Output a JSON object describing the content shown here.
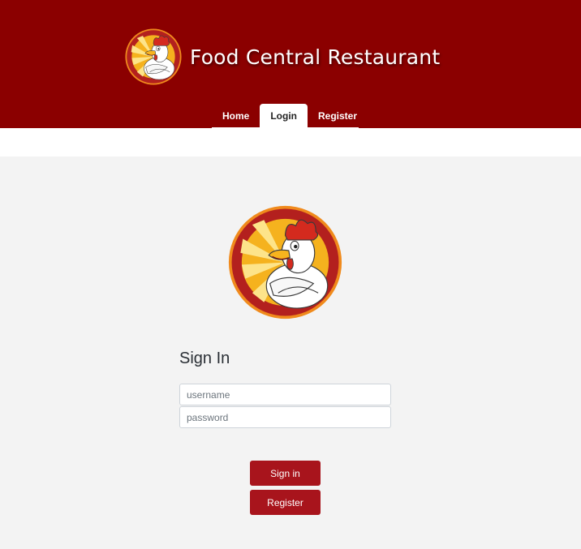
{
  "header": {
    "title": "Food Central Restaurant",
    "logo_icon": "rooster-mascot-icon",
    "background_color": "#8b0000"
  },
  "nav": {
    "items": [
      {
        "label": "Home",
        "active": false
      },
      {
        "label": "Login",
        "active": true
      },
      {
        "label": "Register",
        "active": false
      }
    ]
  },
  "main": {
    "logo_icon": "rooster-mascot-icon",
    "heading": "Sign In",
    "username_placeholder": "username",
    "password_placeholder": "password",
    "signin_label": "Sign in",
    "register_label": "Register",
    "button_color": "#a8141c"
  }
}
